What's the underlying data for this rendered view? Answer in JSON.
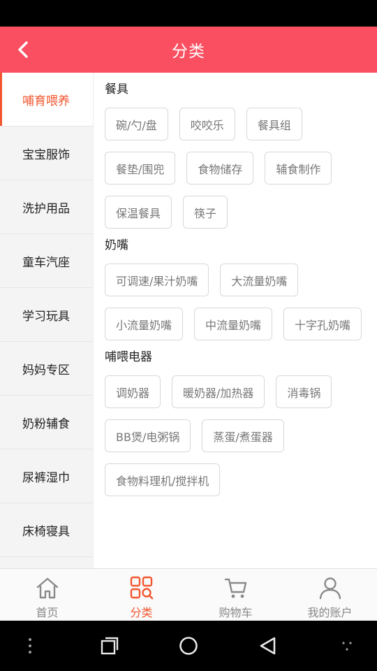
{
  "header": {
    "title": "分类"
  },
  "sidebar": {
    "items": [
      {
        "label": "哺育喂养",
        "active": true
      },
      {
        "label": "宝宝服饰"
      },
      {
        "label": "洗护用品"
      },
      {
        "label": "童车汽座"
      },
      {
        "label": "学习玩具"
      },
      {
        "label": "妈妈专区"
      },
      {
        "label": "奶粉辅食"
      },
      {
        "label": "尿裤湿巾"
      },
      {
        "label": "床椅寝具"
      }
    ]
  },
  "sections": [
    {
      "title": "餐具",
      "tags": [
        "碗/勺/盘",
        "咬咬乐",
        "餐具组",
        "餐垫/围兜",
        "食物储存",
        "辅食制作",
        "保温餐具",
        "筷子"
      ]
    },
    {
      "title": "奶嘴",
      "tags": [
        "可调速/果汁奶嘴",
        "大流量奶嘴",
        "小流量奶嘴",
        "中流量奶嘴",
        "十字孔奶嘴"
      ]
    },
    {
      "title": "哺喂电器",
      "tags": [
        "调奶器",
        "暖奶器/加热器",
        "消毒锅",
        "BB煲/电粥锅",
        "蒸蛋/煮蛋器",
        "食物料理机/搅拌机"
      ]
    }
  ],
  "tabbar": {
    "items": [
      {
        "label": "首页",
        "icon": "home-icon"
      },
      {
        "label": "分类",
        "icon": "category-icon",
        "active": true
      },
      {
        "label": "购物车",
        "icon": "cart-icon"
      },
      {
        "label": "我的账户",
        "icon": "user-icon"
      }
    ]
  },
  "colors": {
    "accent": "#f94f61",
    "active_text": "#f2562f"
  }
}
